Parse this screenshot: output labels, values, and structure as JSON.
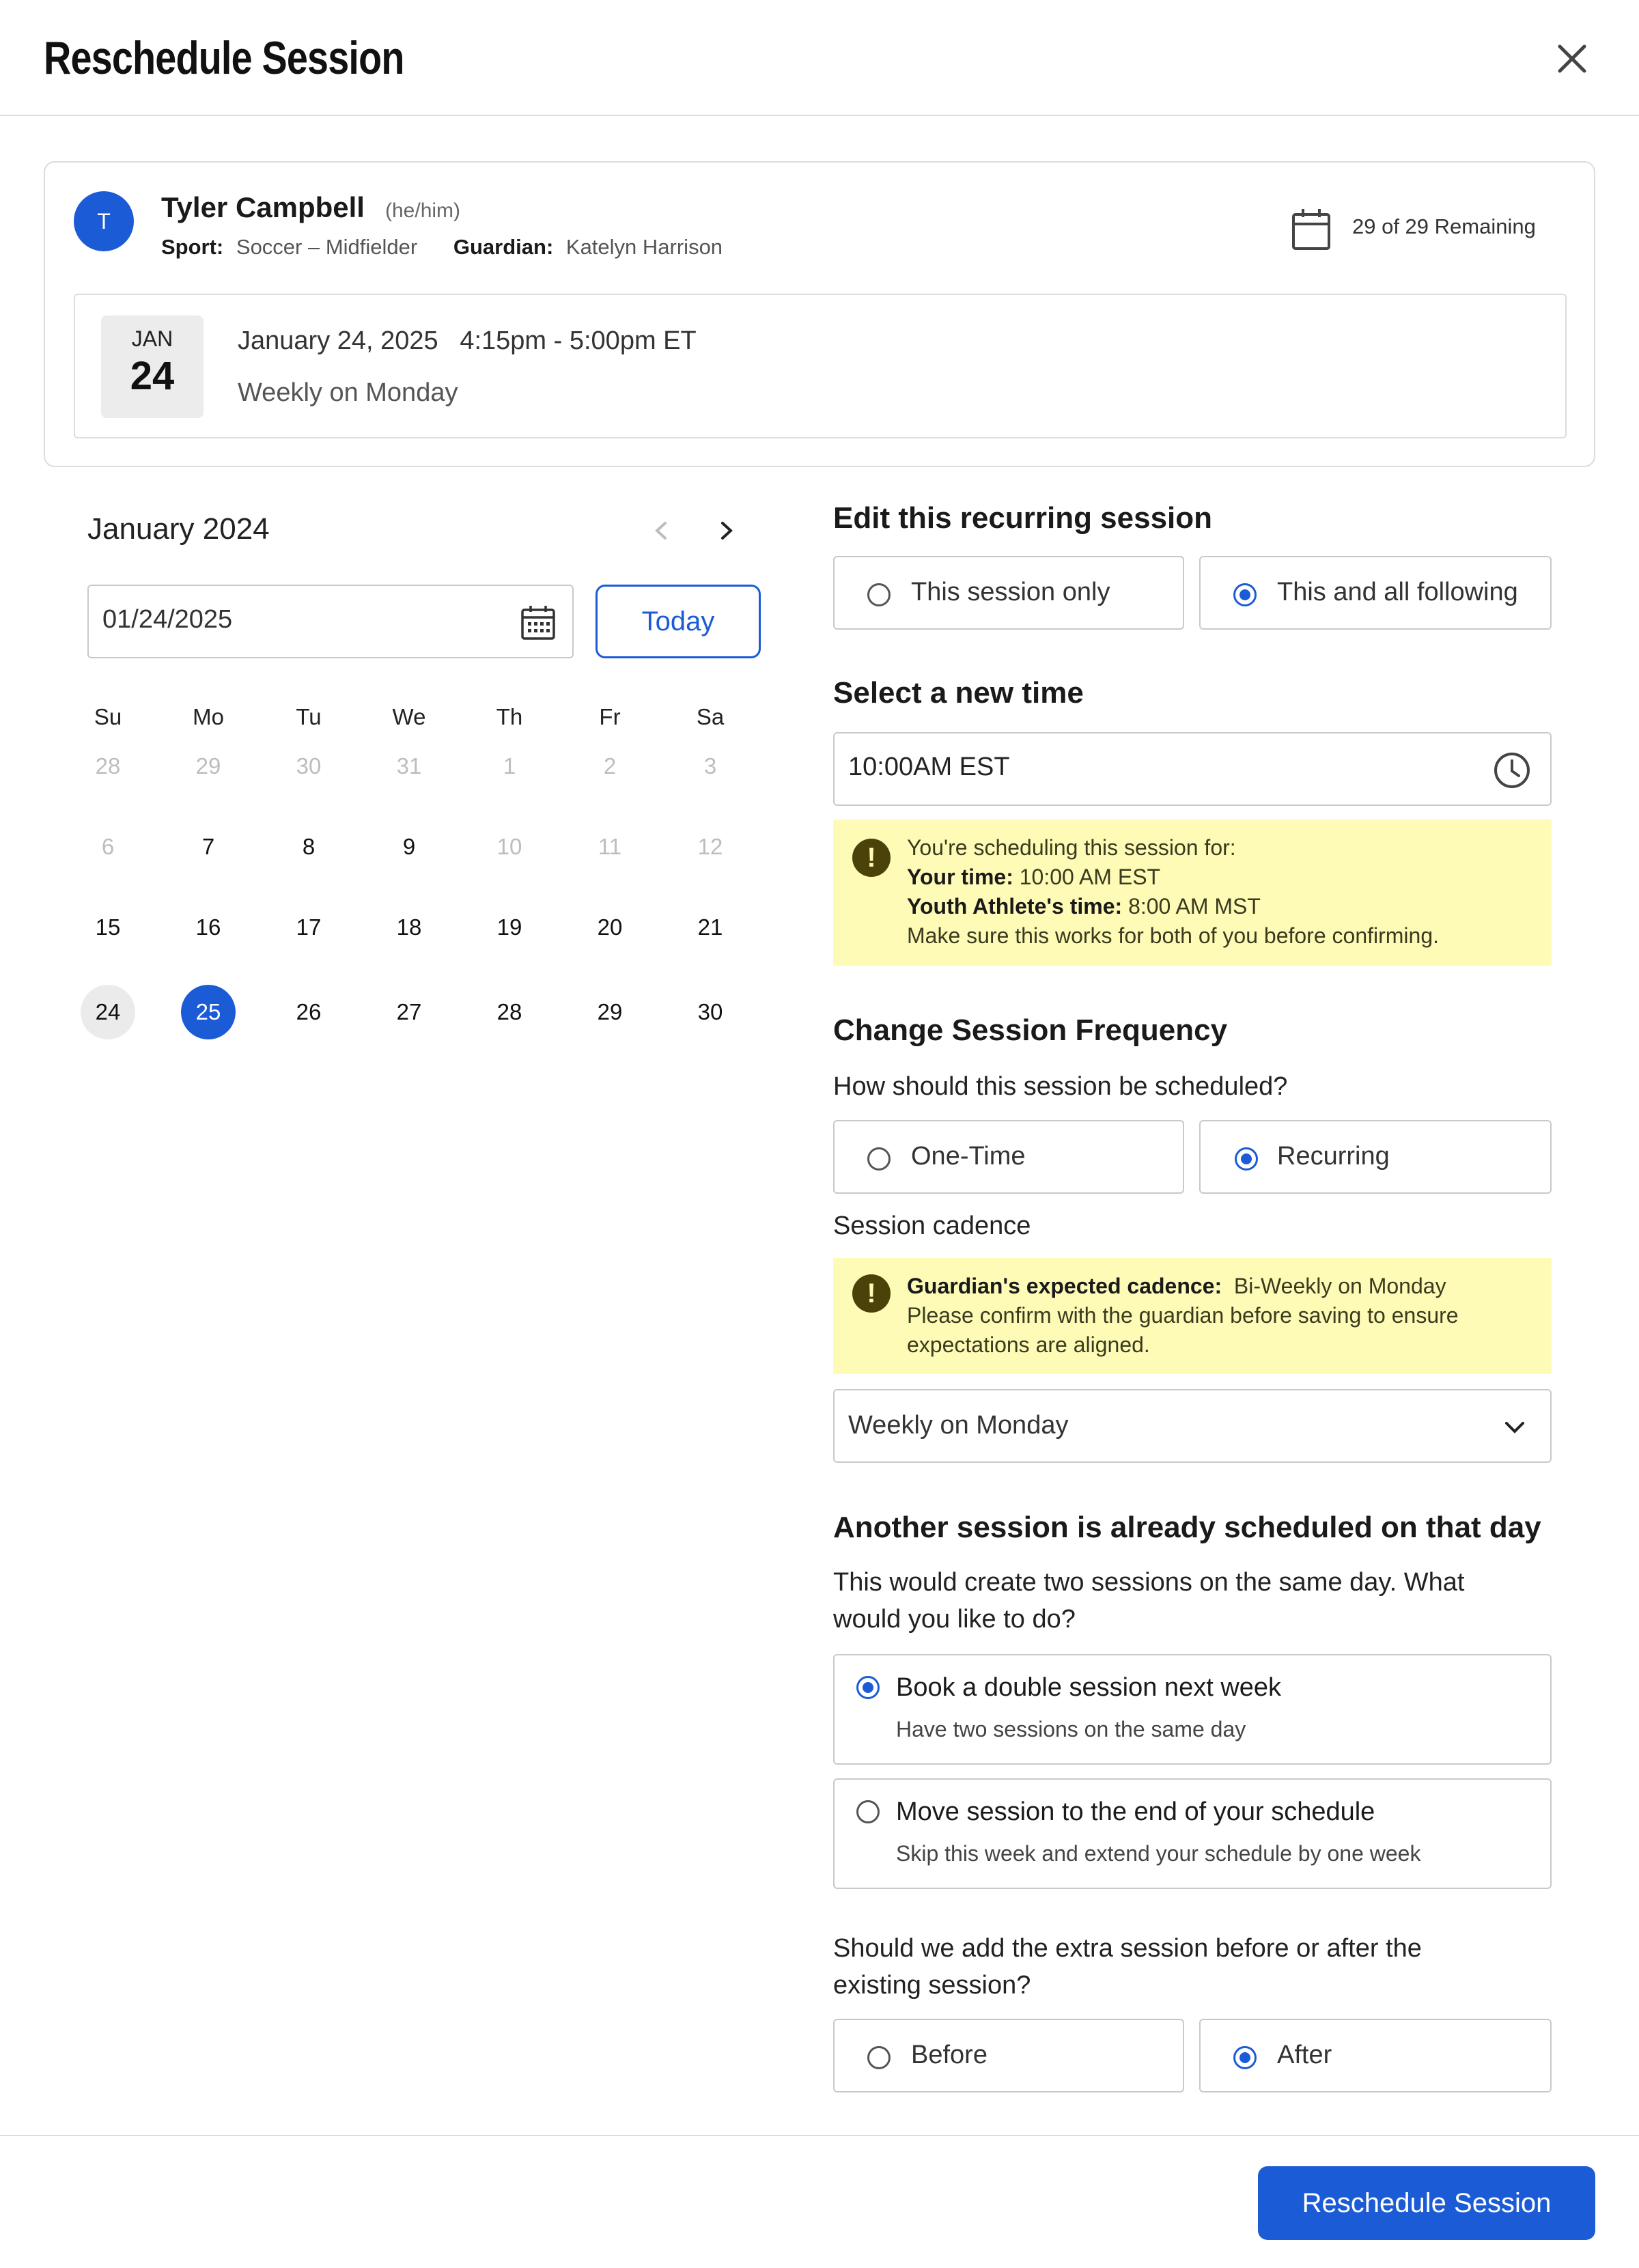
{
  "header": {
    "title": "Reschedule Session",
    "close_label": "close"
  },
  "athlete": {
    "avatar_initial": "T",
    "name": "Tyler Campbell",
    "pronouns": "(he/him)",
    "sport_label": "Sport:",
    "sport_value": "Soccer – Midfielder",
    "guardian_label": "Guardian:",
    "guardian_value": "Katelyn Harrison",
    "remaining": "29 of 29 Remaining"
  },
  "current_session": {
    "month": "JAN",
    "day": "24",
    "when": "January 24, 2025   4:15pm - 5:00pm ET",
    "recurrence": "Weekly on Monday"
  },
  "calendar": {
    "month_label": "January 2024",
    "date_value": "01/24/2025",
    "today_label": "Today",
    "days_of_week": [
      "Su",
      "Mo",
      "Tu",
      "We",
      "Th",
      "Fr",
      "Sa"
    ],
    "weeks": [
      [
        {
          "d": "28",
          "muted": true
        },
        {
          "d": "29",
          "muted": true
        },
        {
          "d": "30",
          "muted": true
        },
        {
          "d": "31",
          "muted": true
        },
        {
          "d": "1",
          "muted": true
        },
        {
          "d": "2",
          "muted": true
        },
        {
          "d": "3",
          "muted": true
        }
      ],
      [
        {
          "d": "6",
          "muted": true
        },
        {
          "d": "7"
        },
        {
          "d": "8"
        },
        {
          "d": "9"
        },
        {
          "d": "10",
          "muted": true
        },
        {
          "d": "11",
          "muted": true
        },
        {
          "d": "12",
          "muted": true
        }
      ],
      [
        {
          "d": "15"
        },
        {
          "d": "16"
        },
        {
          "d": "17"
        },
        {
          "d": "18"
        },
        {
          "d": "19"
        },
        {
          "d": "20"
        },
        {
          "d": "21"
        }
      ],
      [
        {
          "d": "24",
          "state": "today"
        },
        {
          "d": "25",
          "state": "selected"
        },
        {
          "d": "26"
        },
        {
          "d": "27"
        },
        {
          "d": "28"
        },
        {
          "d": "29"
        },
        {
          "d": "30"
        }
      ]
    ],
    "accent": "#1b5cd6"
  },
  "edit_recurring": {
    "heading": "Edit this recurring session",
    "options": [
      "This session only",
      "This and all following"
    ],
    "selected": "This and all following"
  },
  "new_time": {
    "heading": "Select a new time",
    "value": "10:00AM EST",
    "warning": {
      "line1": "You're scheduling this session for:",
      "your_time_label": "Your time:",
      "your_time_value": "10:00 AM EST",
      "athlete_time_label": "Youth Athlete's time:",
      "athlete_time_value": "8:00 AM MST",
      "line4": "Make sure this works for both of you before confirming."
    }
  },
  "frequency": {
    "heading": "Change Session Frequency",
    "question": "How should this session be scheduled?",
    "options": [
      "One-Time",
      "Recurring"
    ],
    "selected": "Recurring",
    "cadence_label": "Session cadence",
    "cadence_warning": {
      "label": "Guardian's expected cadence:",
      "value": "Bi-Weekly on Monday",
      "line2": "Please confirm with the guardian before saving to ensure",
      "line3": "expectations are aligned."
    },
    "cadence_value": "Weekly on Monday"
  },
  "conflict": {
    "heading": "Another session is already scheduled on that day",
    "desc_line1": "This would create two sessions on the same day. What",
    "desc_line2": "would you like to do?",
    "options": [
      {
        "title": "Book a double session next week",
        "subtitle": "Have two sessions on the same day",
        "selected": true
      },
      {
        "title": "Move session to the end of your schedule",
        "subtitle": "Skip this week and extend your schedule by one week",
        "selected": false
      }
    ],
    "order_question_line1": "Should we add the extra session before or after the",
    "order_question_line2": "existing session?",
    "order_options": [
      "Before",
      "After"
    ],
    "order_selected": "After"
  },
  "footer": {
    "submit_label": "Reschedule Session"
  }
}
